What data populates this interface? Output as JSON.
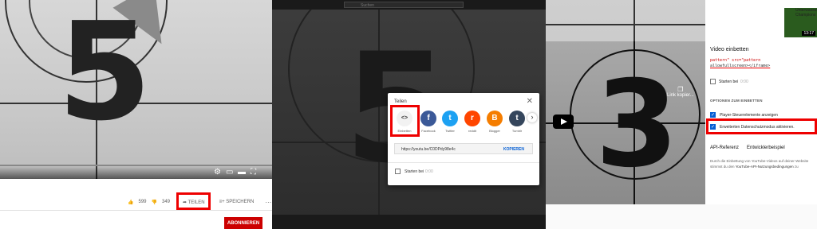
{
  "panel1": {
    "countdown_number": "5",
    "actions": {
      "likes": "599",
      "dislikes": "349",
      "share_label": "TEILEN",
      "save_label": "SPEICHERN",
      "more_label": "···"
    },
    "subscribe_label": "ABONNIEREN"
  },
  "panel2": {
    "search_placeholder": "Suchen",
    "countdown_number": "5",
    "dialog": {
      "title": "Teilen",
      "close_glyph": "✕",
      "targets": [
        {
          "label": "Einbetten",
          "glyph": "<>",
          "color": "#f2f2f2",
          "icon": "embed-icon"
        },
        {
          "label": "Facebook",
          "glyph": "f",
          "color": "#3b5998",
          "icon": "facebook-icon"
        },
        {
          "label": "Twitter",
          "glyph": "t",
          "color": "#1da1f2",
          "icon": "twitter-icon"
        },
        {
          "label": "reddit",
          "glyph": "r",
          "color": "#ff4500",
          "icon": "reddit-icon"
        },
        {
          "label": "Blogger",
          "glyph": "B",
          "color": "#f57d00",
          "icon": "blogger-icon"
        },
        {
          "label": "Tumblr",
          "glyph": "t",
          "color": "#35465c",
          "icon": "tumblr-icon"
        }
      ],
      "next_glyph": "›",
      "link": "https://youtu.be/C0DPdy98e4c",
      "copy_label": "KOPIEREN",
      "start_label": "Starten bei",
      "start_time": "0:00"
    }
  },
  "panel3": {
    "countdown_number": "3",
    "copy_link_label": "Link kopier...",
    "sidebar": {
      "title": "Video einbetten",
      "code_lines": [
        "pattern\" src=\"pattern",
        "allowfullscreen></iframe>"
      ],
      "start_label": "Starten bei",
      "start_time": "0:00",
      "options_heading": "OPTIONEN ZUM EINBETTEN",
      "option_controls": "Player-Steuerelemente anzeigen",
      "option_privacy": "Erweiterten Datenschutzmodus aktivieren.",
      "tab_api": "API-Referenz",
      "tab_dev": "Entwicklerbeispiel",
      "desc": "Durch die Einbettung von YouTube-Videos auf deiner Website stimmst du den",
      "desc_link": "YouTube-API-Nutzungsbedingungen",
      "desc_end": " zu"
    },
    "thumb_title": "Unterwasser Champions",
    "thumb_duration": "13:17"
  },
  "colors": {
    "highlight": "#e00000",
    "brand_red": "#cc0000",
    "link_blue": "#065fd4"
  }
}
